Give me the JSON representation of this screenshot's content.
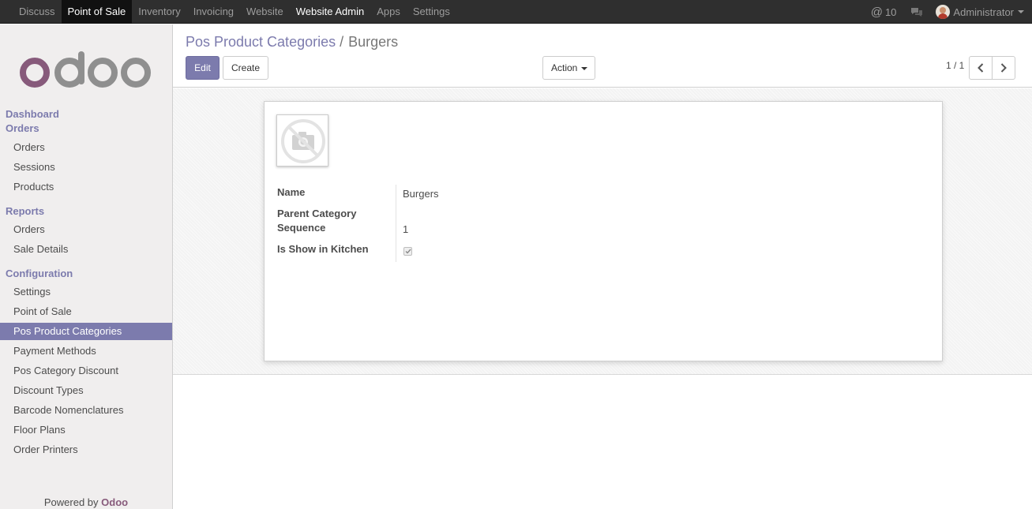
{
  "topbar": {
    "apps": [
      "Discuss",
      "Point of Sale",
      "Inventory",
      "Invoicing",
      "Website",
      "Website Admin",
      "Apps",
      "Settings"
    ],
    "active_app": "Point of Sale",
    "mention_count": "10",
    "user_name": "Administrator"
  },
  "sidebar": {
    "sections": {
      "dashboard": "Dashboard",
      "orders": "Orders",
      "reports": "Reports",
      "configuration": "Configuration"
    },
    "orders_items": [
      "Orders",
      "Sessions",
      "Products"
    ],
    "reports_items": [
      "Orders",
      "Sale Details"
    ],
    "config_items": [
      "Settings",
      "Point of Sale",
      "Pos Product Categories",
      "Payment Methods",
      "Pos Category Discount",
      "Discount Types",
      "Barcode Nomenclatures",
      "Floor Plans",
      "Order Printers"
    ],
    "active_item": "Pos Product Categories",
    "powered_by": "Powered by",
    "powered_brand": "Odoo"
  },
  "control_panel": {
    "breadcrumb_parent": "Pos Product Categories",
    "breadcrumb_separator": "/",
    "breadcrumb_current": "Burgers",
    "edit_label": "Edit",
    "create_label": "Create",
    "action_label": "Action",
    "pager_value": "1 / 1"
  },
  "form": {
    "fields": {
      "name_label": "Name",
      "name_value": "Burgers",
      "parent_label": "Parent Category",
      "parent_value": "",
      "sequence_label": "Sequence",
      "sequence_value": "1",
      "kitchen_label": "Is Show in Kitchen",
      "kitchen_value": true
    }
  },
  "colors": {
    "primary": "#7c7bad",
    "topbar": "#2f2f2f",
    "brand": "#875a7b"
  },
  "icons": {
    "mention": "at-icon",
    "chat": "comments-icon",
    "pager_prev": "chevron-left-icon",
    "pager_next": "chevron-right-icon",
    "placeholder_image": "no-camera-icon",
    "checkbox": "check-icon"
  }
}
